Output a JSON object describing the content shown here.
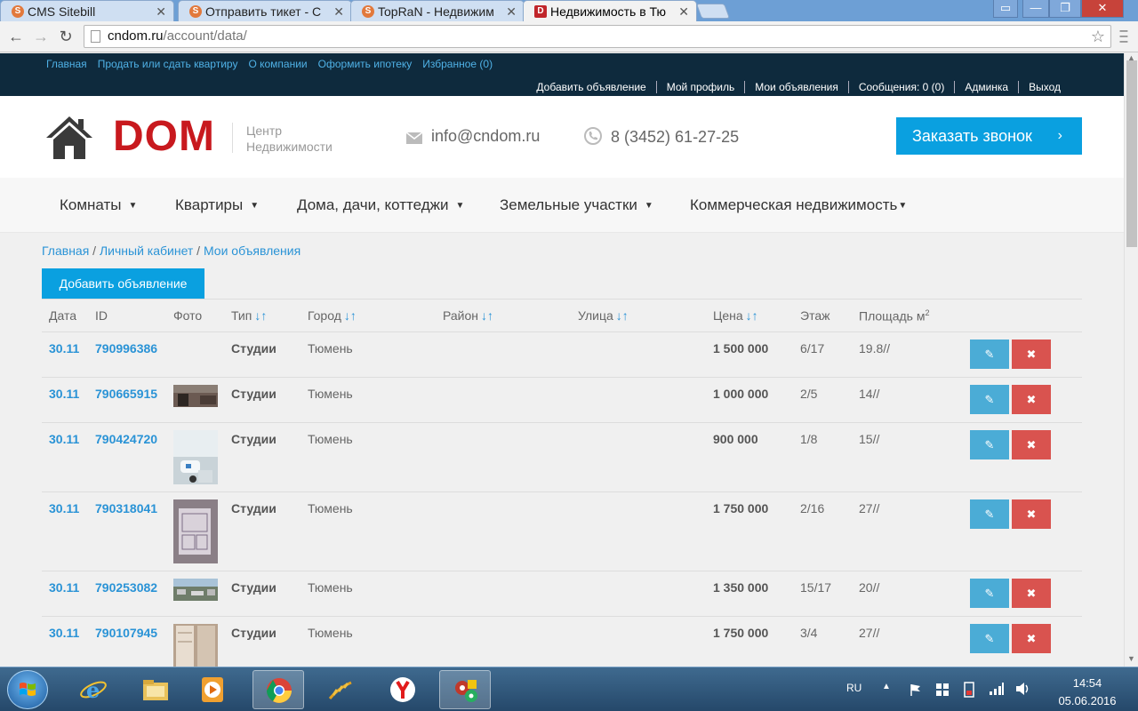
{
  "browser": {
    "tabs": [
      {
        "title": "CMS Sitebill",
        "favicon": "S"
      },
      {
        "title": "Отправить тикет - С",
        "favicon": "S"
      },
      {
        "title": "TopRaN - Недвижим",
        "favicon": "S"
      },
      {
        "title": "Недвижимость в Тю",
        "favicon": "D",
        "active": true
      }
    ],
    "url_host": "cndom.ru",
    "url_path": "/account/data/"
  },
  "topbar": {
    "links": [
      "Главная",
      "Продать или сдать квартиру",
      "О компании",
      "Оформить ипотеку",
      "Избранное (0)"
    ],
    "user_links": [
      "Добавить объявление",
      "Мой профиль",
      "Мои объявления",
      "Сообщения: 0 (0)",
      "Админка",
      "Выход"
    ]
  },
  "header": {
    "logo": "DOM",
    "subtitle_line1": "Центр",
    "subtitle_line2": "Недвижимости",
    "email": "info@cndom.ru",
    "phone": "8 (3452) 61-27-25",
    "call_button": "Заказать звонок"
  },
  "nav": [
    "Комнаты",
    "Квартиры",
    "Дома, дачи, коттеджи",
    "Земельные участки",
    "Коммерческая недвижимость"
  ],
  "breadcrumb": [
    "Главная",
    "Личный кабинет",
    "Мои объявления"
  ],
  "add_button": "Добавить объявление",
  "table": {
    "headers": [
      "Дата",
      "ID",
      "Фото",
      "Тип",
      "Город",
      "Район",
      "Улица",
      "Цена",
      "Этаж",
      "Площадь м"
    ],
    "area_sup": "2",
    "rows": [
      {
        "date": "30.11",
        "id": "790996386",
        "type": "Студии",
        "city": "Тюмень",
        "price": "1 500 000",
        "floor": "6/17",
        "area": "19.8//",
        "photo": "none"
      },
      {
        "date": "30.11",
        "id": "790665915",
        "type": "Студии",
        "city": "Тюмень",
        "price": "1 000 000",
        "floor": "2/5",
        "area": "14//",
        "photo": "room"
      },
      {
        "date": "30.11",
        "id": "790424720",
        "type": "Студии",
        "city": "Тюмень",
        "price": "900 000",
        "floor": "1/8",
        "area": "15//",
        "photo": "bath"
      },
      {
        "date": "30.11",
        "id": "790318041",
        "type": "Студии",
        "city": "Тюмень",
        "price": "1 750 000",
        "floor": "2/16",
        "area": "27//",
        "photo": "plan"
      },
      {
        "date": "30.11",
        "id": "790253082",
        "type": "Студии",
        "city": "Тюмень",
        "price": "1 350 000",
        "floor": "15/17",
        "area": "20//",
        "photo": "view"
      },
      {
        "date": "30.11",
        "id": "790107945",
        "type": "Студии",
        "city": "Тюмень",
        "price": "1 750 000",
        "floor": "3/4",
        "area": "27//",
        "photo": "door"
      }
    ]
  },
  "taskbar": {
    "lang": "RU",
    "time": "14:54",
    "date": "05.06.2016"
  },
  "colors": {
    "accent": "#0aa0e0",
    "logo_red": "#c8191e",
    "topbar": "#0e2a3d",
    "delete": "#d9534f",
    "edit": "#4bacd6"
  }
}
